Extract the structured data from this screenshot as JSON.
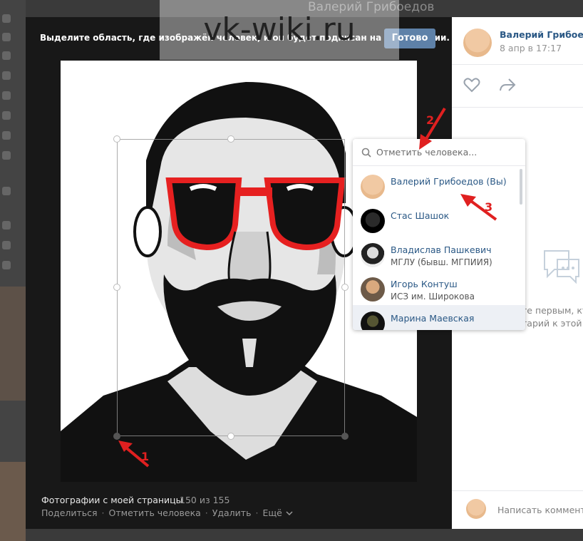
{
  "background": {
    "title": "Валерий Грибоедов"
  },
  "viewer": {
    "hint": "Выделите область, где изображён человек, и он будет подписан на фотографии.",
    "done_label": "Готово",
    "watermark": "vk-wiki.ru",
    "album": "Фотографии с моей страницы",
    "counter": "150 из 155",
    "actions": {
      "share": "Поделиться",
      "tag": "Отметить человека",
      "delete": "Удалить",
      "more": "Ещё"
    }
  },
  "tag_dropdown": {
    "placeholder": "Отметить человека...",
    "people": [
      {
        "name": "Валерий Грибоедов (Вы)",
        "sub": ""
      },
      {
        "name": "Стас Шашок",
        "sub": ""
      },
      {
        "name": "Владислав Пашкевич",
        "sub": "МГЛУ (бывш. МГПИИЯ)"
      },
      {
        "name": "Игорь Контуш",
        "sub": "ИСЗ им. Широкова"
      },
      {
        "name": "Марина Маевская",
        "sub": ""
      }
    ]
  },
  "annotations": [
    "1",
    "2",
    "3"
  ],
  "side_panel": {
    "author": "Валерий Грибоедов",
    "date": "8 апр в 17:17",
    "empty_line1": "те первым, кто",
    "empty_line2": "тарий к этой ф",
    "comment_placeholder": "Написать коммента"
  },
  "colors": {
    "link": "#2a5885",
    "accent_button": "#5e81a8",
    "arrow": "#e02020",
    "glasses": "#e62020"
  }
}
